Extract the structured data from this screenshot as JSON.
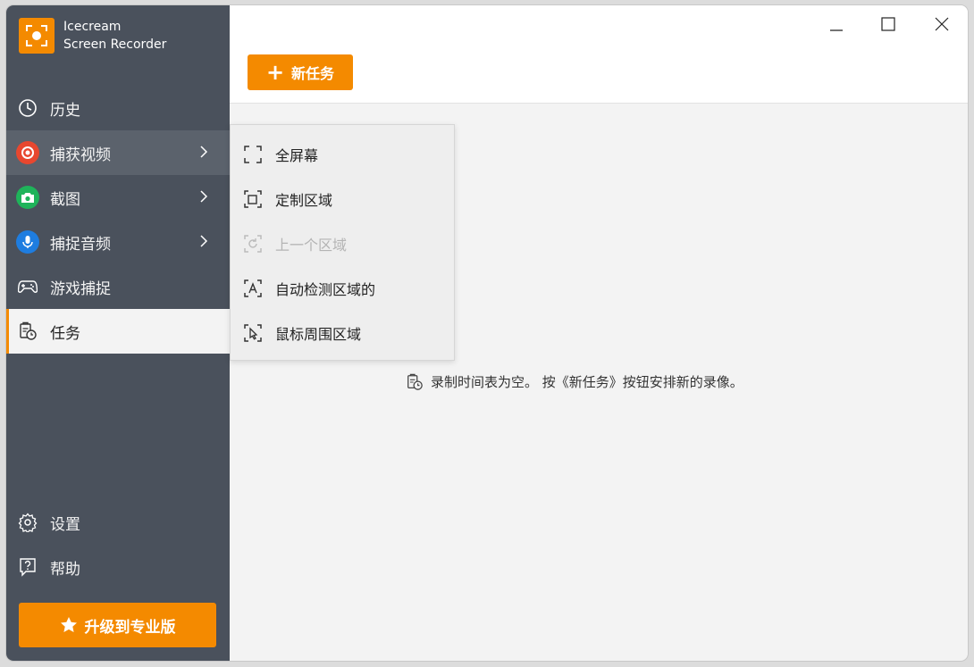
{
  "app": {
    "name_line1": "Icecream",
    "name_line2": "Screen Recorder"
  },
  "sidebar": {
    "items": [
      {
        "label": "历史",
        "icon": "clock-icon"
      },
      {
        "label": "捕获视频",
        "icon": "record-icon",
        "icon_color": "#e8472f",
        "has_submenu": true
      },
      {
        "label": "截图",
        "icon": "camera-icon",
        "icon_color": "#1fb35a",
        "has_submenu": true
      },
      {
        "label": "捕捉音频",
        "icon": "microphone-icon",
        "icon_color": "#1e7de0",
        "has_submenu": true
      },
      {
        "label": "游戏捕捉",
        "icon": "gamepad-icon"
      },
      {
        "label": "任务",
        "icon": "task-icon",
        "active": true
      }
    ],
    "bottom_items": [
      {
        "label": "设置",
        "icon": "gear-icon"
      },
      {
        "label": "帮助",
        "icon": "help-icon"
      }
    ],
    "upgrade_label": "升级到专业版"
  },
  "toolbar": {
    "new_task_label": "新任务"
  },
  "submenu": {
    "items": [
      {
        "label": "全屏幕",
        "icon": "fullscreen-icon",
        "enabled": true
      },
      {
        "label": "定制区域",
        "icon": "custom-area-icon",
        "enabled": true
      },
      {
        "label": "上一个区域",
        "icon": "previous-area-icon",
        "enabled": false
      },
      {
        "label": "自动检测区域的",
        "icon": "auto-detect-icon",
        "enabled": true
      },
      {
        "label": "鼠标周围区域",
        "icon": "cursor-area-icon",
        "enabled": true
      }
    ]
  },
  "main": {
    "empty_message": "录制时间表为空。 按《新任务》按钮安排新的录像。"
  },
  "colors": {
    "accent": "#f48a00",
    "sidebar_bg": "#4a515c"
  }
}
